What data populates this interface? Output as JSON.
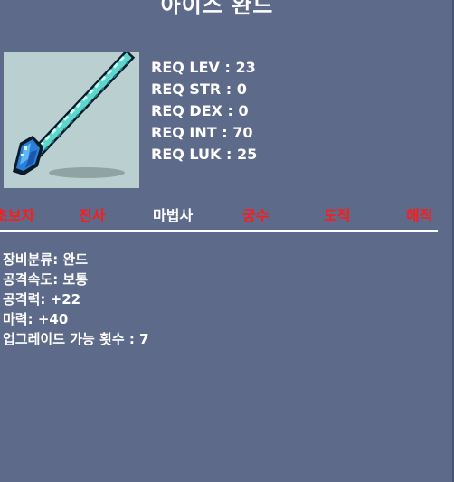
{
  "item": {
    "name": "아이스 완드",
    "icon": "ice-wand-sprite"
  },
  "requirements": [
    "REQ LEV : 23",
    "REQ STR : 0",
    "REQ DEX : 0",
    "REQ INT : 70",
    "REQ LUK : 25"
  ],
  "jobs": [
    {
      "label": "초보자",
      "allowed": false
    },
    {
      "label": "전사",
      "allowed": false
    },
    {
      "label": "마법사",
      "allowed": true
    },
    {
      "label": "궁수",
      "allowed": false
    },
    {
      "label": "도적",
      "allowed": false
    },
    {
      "label": "해적",
      "allowed": false
    }
  ],
  "stats": [
    "장비분류: 완드",
    "공격속도: 보통",
    "공격력: +22",
    "마력: +40",
    "업그레이드 가능 횟수 : 7"
  ],
  "colors": {
    "background": "#5e6a8a",
    "image_background": "#b9cfd0",
    "allowed_job": "#ffffff",
    "disallowed_job": "#ff1a1a",
    "text": "#ffffff"
  }
}
